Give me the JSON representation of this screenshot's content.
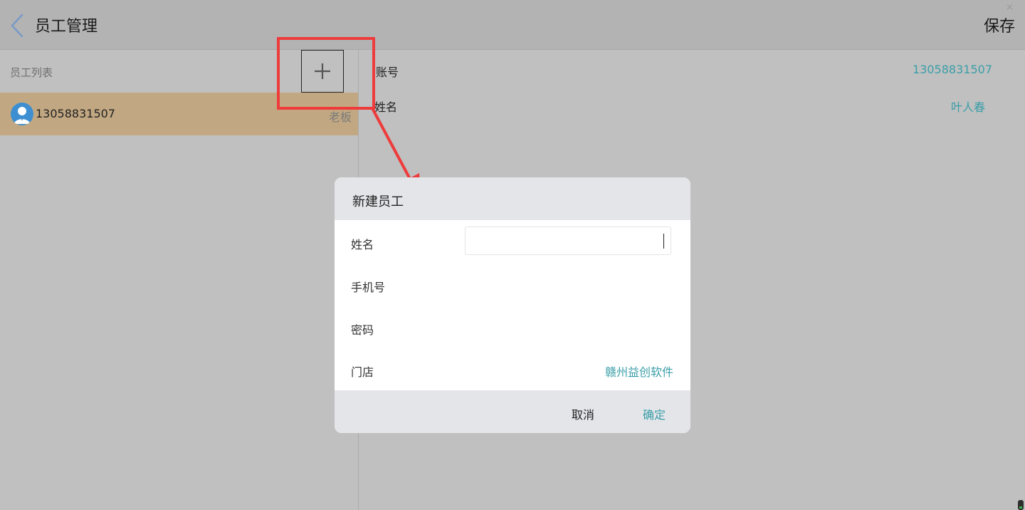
{
  "header": {
    "title": "员工管理",
    "save_label": "保存",
    "close_glyph": "×"
  },
  "employee_list": {
    "title": "员工列表",
    "add_icon": "plus-icon",
    "items": [
      {
        "account": "13058831507",
        "role": "老板",
        "avatar_icon": "user-avatar-icon"
      }
    ]
  },
  "detail": {
    "account_label": "账号",
    "account_value": "13058831507",
    "name_label": "姓名",
    "name_value": "叶人春"
  },
  "dialog": {
    "title": "新建员工",
    "name_label": "姓名",
    "name_value": "",
    "name_placeholder": "",
    "phone_label": "手机号",
    "password_label": "密码",
    "store_label": "门店",
    "store_value": "赣州益创软件",
    "cancel_label": "取消",
    "confirm_label": "确定"
  },
  "colors": {
    "accent": "#3a9ea8",
    "highlight_red": "#ee3b3b",
    "selected_row": "#c2a882",
    "overlay_gray": "#c0c0c0"
  }
}
